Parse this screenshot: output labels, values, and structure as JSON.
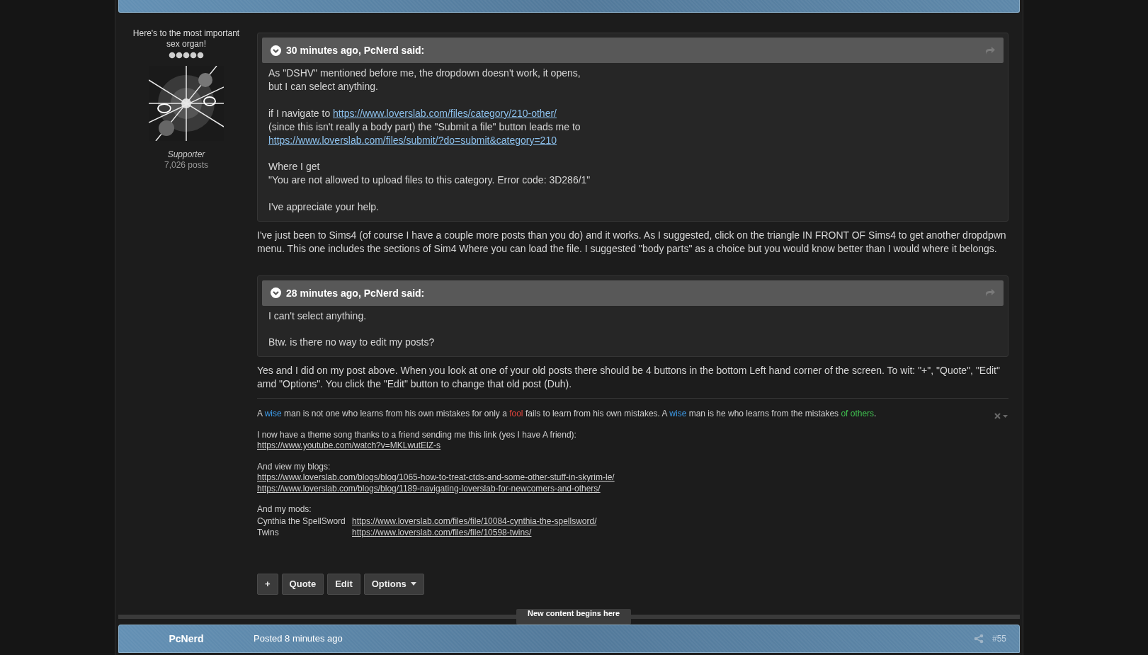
{
  "author": {
    "title": "Here's to the most important sex organ!",
    "group": "Supporter",
    "post_count": "7,026 posts"
  },
  "content": [
    {
      "kind": "quote",
      "header": "30 minutes ago, PcNerd said:",
      "paragraphs": [
        [
          [
            {
              "text": "As \"DSHV\" mentioned before me, the dropdown doesn't work, it opens,"
            }
          ],
          [
            {
              "text": "but I can select anything."
            }
          ]
        ],
        [
          [
            {
              "text": "if I navigate to "
            },
            {
              "text": "https://www.loverslab.com/files/category/210-other/",
              "link": true
            }
          ],
          [
            {
              "text": "(since this isn't really a body part) the \"Submit a file\" button leads me to"
            }
          ],
          [
            {
              "text": "https://www.loverslab.com/files/submit/?do=submit&category=210",
              "link": true
            }
          ]
        ],
        [
          [
            {
              "text": "Where I get"
            }
          ],
          [
            {
              "text": "\"You are not allowed to upload files to this category. Error code: 3D286/1\""
            }
          ]
        ],
        [
          [
            {
              "text": "I've appreciate your help."
            }
          ]
        ]
      ]
    },
    {
      "kind": "text",
      "text": "I've just been to Sims4 (of course I have a couple more posts than you do) and it works. As I suggested, click on the triangle IN FRONT OF Sims4 to get another dropdpwn menu. This one includes the sections of Sim4 Where you can load the file. I suggested \"body parts\" as a choice but you would know better than I would where it belongs."
    },
    {
      "kind": "quote",
      "header": "28 minutes ago, PcNerd said:",
      "paragraphs": [
        [
          [
            {
              "text": "I can't select anything."
            }
          ]
        ],
        [
          [
            {
              "text": "Btw. is there no way to edit my posts?"
            }
          ]
        ]
      ]
    },
    {
      "kind": "text",
      "text": "Yes and I did on my post above. When you look at one of your old posts there should be 4 buttons in the bottom Left hand corner of the screen. To wit: \"+\", \"Quote\", \"Edit\" amd \"Options\". You click the \"Edit\" button to change that old post (Duh)."
    }
  ],
  "signature": {
    "paragraphs": [
      [
        [
          {
            "text": "A "
          },
          {
            "text": "wise",
            "color": "#3d9be9"
          },
          {
            "text": " man is not one who learns from his own mistakes for only a "
          },
          {
            "text": "fool",
            "color": "#e0443c"
          },
          {
            "text": " fails to learn from his own mistakes. A "
          },
          {
            "text": "wise",
            "color": "#3d9be9"
          },
          {
            "text": " man is he who learns from the mistakes "
          },
          {
            "text": "of others",
            "color": "#3fbf4f"
          },
          {
            "text": "."
          }
        ]
      ],
      [
        [
          {
            "text": "I now have a theme song thanks to a friend sending me this link (yes I have A friend):"
          }
        ],
        [
          {
            "text": "https://www.youtube.com/watch?v=MKLwutElZ-s",
            "link": true
          }
        ]
      ],
      [
        [
          {
            "text": "And view my blogs:"
          }
        ],
        [
          {
            "text": "https://www.loverslab.com/blogs/blog/1065-how-to-treat-ctds-and-some-other-stuff-in-skyrim-le/",
            "link": true
          }
        ],
        [
          {
            "text": "https://www.loverslab.com/blogs/blog/1189-navigating-loverslab-for-newcomers-and-others/",
            "link": true
          }
        ]
      ],
      [
        [
          {
            "text": "And my mods:"
          }
        ]
      ]
    ],
    "mods": [
      {
        "name": "Cynthia the SpellSword",
        "url": "https://www.loverslab.com/files/file/10084-cynthia-the-spellsword/"
      },
      {
        "name": "Twins",
        "url": "https://www.loverslab.com/files/file/10598-twins/"
      }
    ]
  },
  "actions": [
    {
      "label": "+"
    },
    {
      "label": "Quote"
    },
    {
      "label": "Edit"
    },
    {
      "label": "Options",
      "dropdown": true
    }
  ],
  "divider": {
    "label": "New content begins here"
  },
  "next_post": {
    "author": "PcNerd",
    "posted": "Posted 8 minutes ago",
    "number": "#55"
  }
}
